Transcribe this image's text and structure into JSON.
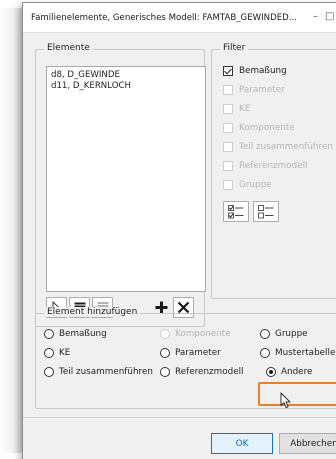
{
  "window": {
    "title": "Familienelemente, Generisches Modell: FAMTAB_GEWINDED...",
    "minimize_glyph": "–",
    "maximize_glyph": "□"
  },
  "elemente": {
    "legend": "Elemente",
    "items": [
      "d8, D_GEWINDE",
      "d11, D_KERNLOCH"
    ],
    "toolbar": {
      "pointer_icon": "pointer-select-icon",
      "select_all_icon": "select-all-list-icon",
      "deselect_all_icon": "deselect-all-list-icon",
      "add_icon": "add-plus-icon",
      "remove_icon": "remove-x-icon"
    }
  },
  "filter": {
    "legend": "Filter",
    "items": [
      {
        "label": "Bemaßung",
        "checked": true,
        "enabled": true
      },
      {
        "label": "Parameter",
        "checked": false,
        "enabled": false
      },
      {
        "label": "KE",
        "checked": false,
        "enabled": false
      },
      {
        "label": "Komponente",
        "checked": false,
        "enabled": false
      },
      {
        "label": "Teil zusammenführen",
        "checked": false,
        "enabled": false
      },
      {
        "label": "Referenzmodell",
        "checked": false,
        "enabled": false
      },
      {
        "label": "Gruppe",
        "checked": false,
        "enabled": false
      }
    ],
    "check_all_icon": "check-all-icon",
    "uncheck_all_icon": "uncheck-all-icon"
  },
  "add_element": {
    "legend": "Element hinzufügen",
    "options": [
      {
        "label": "Bemaßung",
        "selected": false,
        "enabled": true
      },
      {
        "label": "Komponente",
        "selected": false,
        "enabled": false
      },
      {
        "label": "Gruppe",
        "selected": false,
        "enabled": true
      },
      {
        "label": "KE",
        "selected": false,
        "enabled": true
      },
      {
        "label": "Parameter",
        "selected": false,
        "enabled": true
      },
      {
        "label": "Mustertabelle",
        "selected": false,
        "enabled": true
      },
      {
        "label": "Teil zusammenführen",
        "selected": false,
        "enabled": true
      },
      {
        "label": "Referenzmodell",
        "selected": false,
        "enabled": true
      },
      {
        "label": "Andere",
        "selected": true,
        "enabled": true
      }
    ]
  },
  "buttons": {
    "ok": "OK",
    "cancel": "Abbrechen"
  },
  "colors": {
    "highlight": "#e8822a",
    "primary_border": "#0078d7",
    "dialog_bg": "#f0f0f0",
    "disabled_text": "#b5b5b5"
  }
}
